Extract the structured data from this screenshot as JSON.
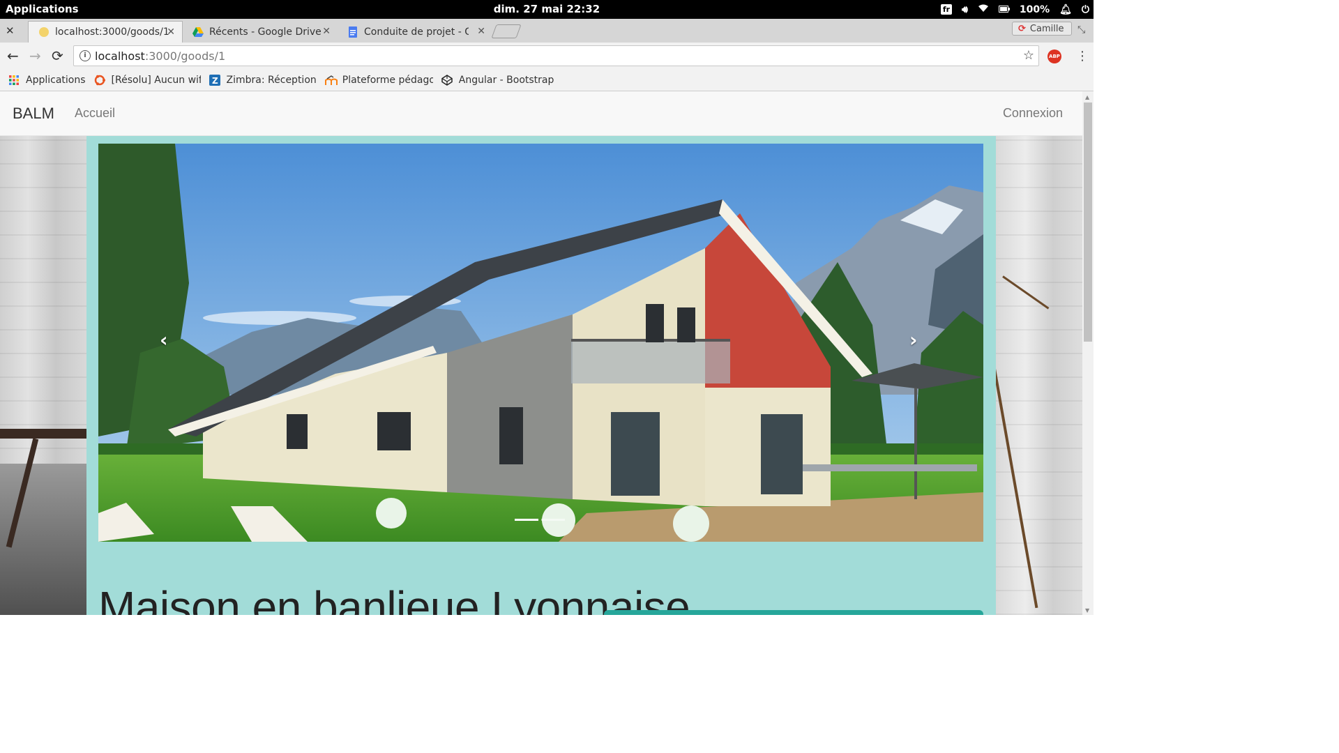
{
  "system": {
    "apps_label": "Applications",
    "clock": "dim. 27 mai   22:32",
    "keyboard": "fr",
    "battery": "100%"
  },
  "browser": {
    "tabs": [
      {
        "title": "localhost:3000/goods/1",
        "active": true
      },
      {
        "title": "Récents - Google Drive",
        "active": false
      },
      {
        "title": "Conduite de projet - Go",
        "active": false
      }
    ],
    "profile": "Camille",
    "url_host": "localhost",
    "url_path": ":3000/goods/1",
    "bookmarks": [
      {
        "label": "Applications",
        "icon": "apps-grid-icon"
      },
      {
        "label": "[Résolu] Aucun wifi",
        "icon": "ubuntu-icon"
      },
      {
        "label": "Zimbra: Réception",
        "icon": "zimbra-icon"
      },
      {
        "label": "Plateforme pédago",
        "icon": "moodle-icon"
      },
      {
        "label": "Angular - Bootstrap",
        "icon": "codepen-icon"
      }
    ]
  },
  "site": {
    "brand": "BALM",
    "nav_home": "Accueil",
    "nav_login": "Connexion",
    "listing_title": "Maison en banlieue Lyonnaise",
    "carousel": {
      "prev": "‹",
      "next": "›",
      "slide_count": 3,
      "active_slide": 1
    }
  },
  "colors": {
    "panel": "#a2dcd8",
    "accent_button": "#26a69a",
    "navbar": "#f8f8f8"
  }
}
